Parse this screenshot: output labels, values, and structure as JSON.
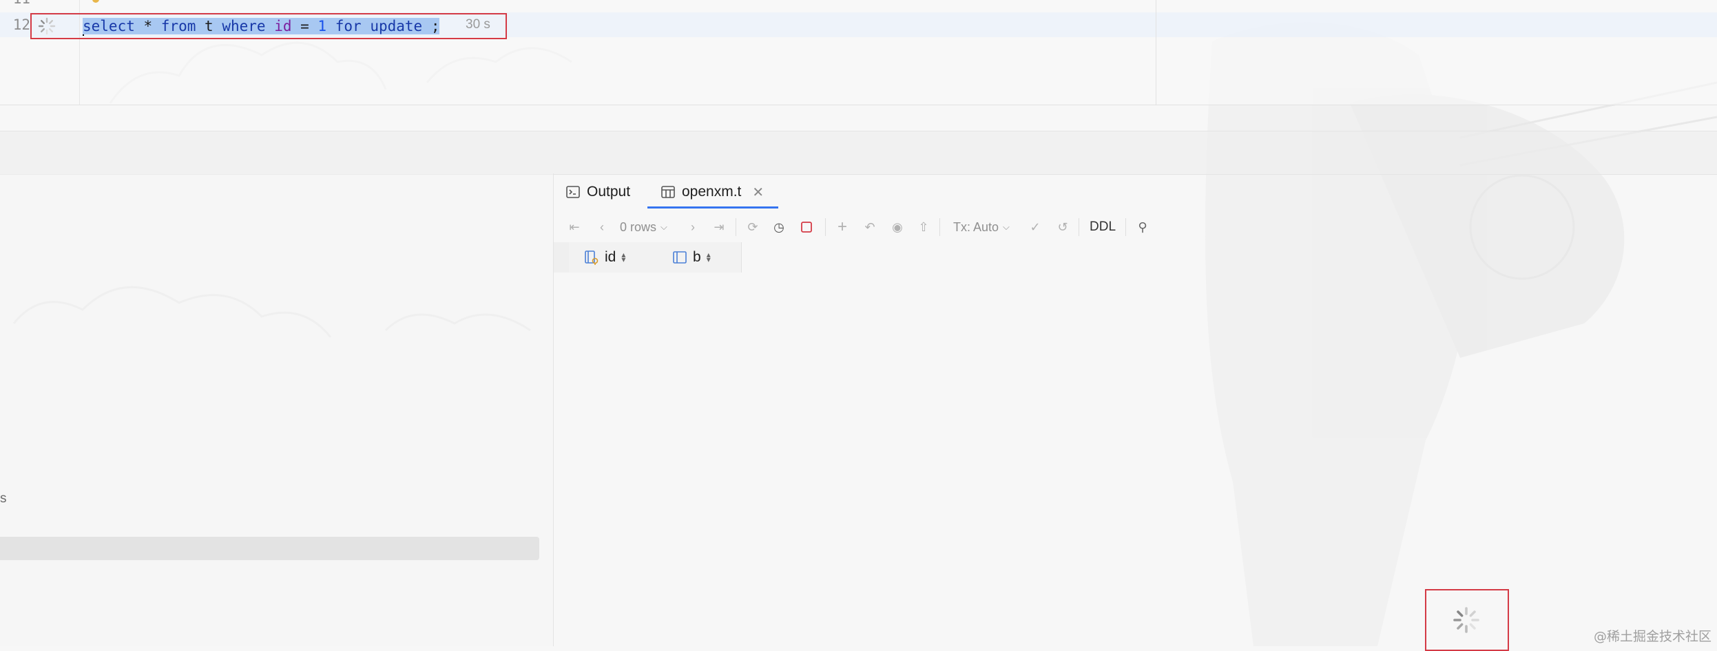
{
  "editor": {
    "line_numbers": [
      "11",
      "12"
    ],
    "query_tokens": [
      {
        "text": "select",
        "kind": "kw"
      },
      {
        "text": " * ",
        "kind": "plain"
      },
      {
        "text": "from",
        "kind": "kw"
      },
      {
        "text": " t ",
        "kind": "plain"
      },
      {
        "text": "where",
        "kind": "kw"
      },
      {
        "text": " ",
        "kind": "plain"
      },
      {
        "text": "id",
        "kind": "id"
      },
      {
        "text": " = ",
        "kind": "plain"
      },
      {
        "text": "1",
        "kind": "num"
      },
      {
        "text": " ",
        "kind": "plain"
      },
      {
        "text": "for",
        "kind": "kw"
      },
      {
        "text": " ",
        "kind": "plain"
      },
      {
        "text": "update",
        "kind": "kw"
      },
      {
        "text": " ;",
        "kind": "plain"
      }
    ],
    "timing": "30 s",
    "status_icon": "loading-spinner-icon"
  },
  "left_panel": {
    "truncated_text": "s"
  },
  "results": {
    "tabs": [
      {
        "label": "Output",
        "icon": "console-icon"
      },
      {
        "label": "openxm.t",
        "icon": "table-icon",
        "active": true
      }
    ],
    "toolbar": {
      "rows_label": "0 rows",
      "tx_label": "Tx: Auto",
      "ddl_label": "DDL"
    },
    "columns": [
      {
        "name": "id",
        "icon": "primary-key-column-icon"
      },
      {
        "name": "b",
        "icon": "column-icon"
      }
    ]
  },
  "colors": {
    "selection": "#a8c8f2",
    "keyword": "#1738a8",
    "identifier": "#7c1f9e",
    "number": "#1750eb",
    "highlight_border": "#d43a45",
    "active_tab": "#3574f0"
  },
  "watermark": "@稀土掘金技术社区"
}
